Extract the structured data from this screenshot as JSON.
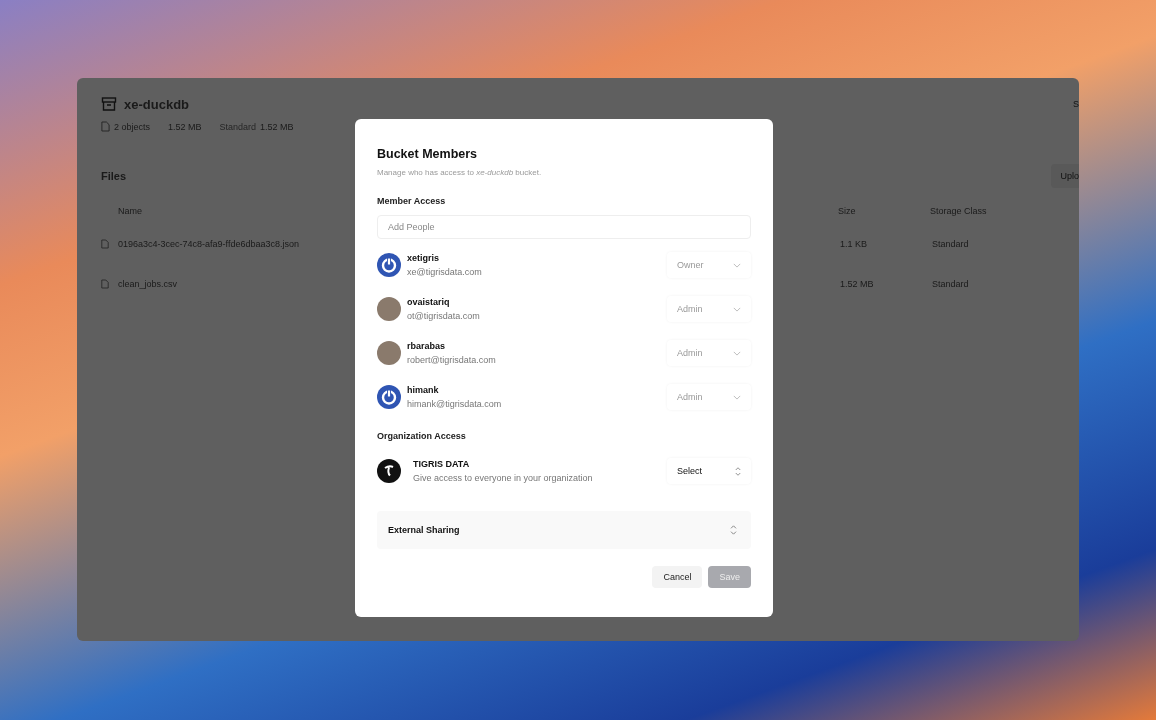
{
  "bucket": {
    "name": "xe-duckdb",
    "objects": "2 objects",
    "size": "1.52 MB",
    "storage_label": "Standard",
    "storage_size": "1.52 MB",
    "corner_button": "S"
  },
  "files": {
    "title": "Files",
    "upload_button": "Uplo",
    "columns": [
      "Name",
      "Size",
      "Storage Class"
    ],
    "rows": [
      {
        "name": "0196a3c4-3cec-74c8-afa9-ffde6dbaa3c8.json",
        "size": "1.1 KB",
        "storage_class": "Standard"
      },
      {
        "name": "clean_jobs.csv",
        "size": "1.52 MB",
        "storage_class": "Standard"
      }
    ]
  },
  "dialog": {
    "title": "Bucket Members",
    "subtitle": "Manage who has access to *xe-duckdb* bucket.",
    "member_access": {
      "label": "Member Access",
      "placeholder": "Add People",
      "members": [
        {
          "name": "xetigris",
          "email": "xe@tigrisdata.com",
          "role": "Owner",
          "disabled": true,
          "kind": "logo"
        },
        {
          "name": "ovaistariq",
          "email": "ot@tigrisdata.com",
          "role": "Admin",
          "disabled": true,
          "kind": "photo"
        },
        {
          "name": "rbarabas",
          "email": "robert@tigrisdata.com",
          "role": "Admin",
          "disabled": true,
          "kind": "photo"
        },
        {
          "name": "himank",
          "email": "himank@tigrisdata.com",
          "role": "Admin",
          "disabled": true,
          "kind": "logo"
        }
      ]
    },
    "organization_access": {
      "label": "Organization Access",
      "name": "TIGRIS DATA",
      "description": "Give access to everyone in your organization",
      "select": "Select"
    },
    "external_sharing": {
      "label": "External Sharing",
      "expanded": false
    },
    "buttons": [
      {
        "label": "Cancel",
        "kind": "secondary",
        "disabled": false
      },
      {
        "label": "Save",
        "kind": "primary",
        "disabled": true
      }
    ]
  }
}
